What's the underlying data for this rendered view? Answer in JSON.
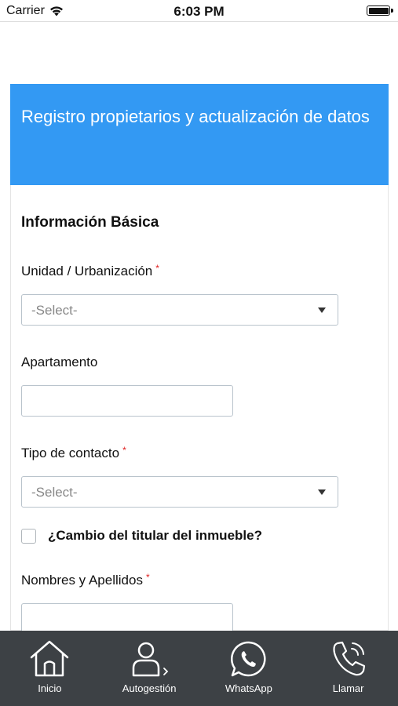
{
  "status_bar": {
    "carrier": "Carrier",
    "time": "6:03 PM",
    "wifi_icon": "wifi-icon",
    "battery_icon": "battery-icon"
  },
  "form": {
    "header_title": "Registro propietarios y actualización de datos",
    "header_color": "#3399f3",
    "section_title": "Información Básica",
    "fields": {
      "unidad": {
        "label": "Unidad / Urbanización",
        "required_mark": "*",
        "value": "-Select-"
      },
      "apartamento": {
        "label": "Apartamento",
        "value": ""
      },
      "tipo_contacto": {
        "label": "Tipo de contacto",
        "required_mark": "*",
        "value": "-Select-"
      },
      "cambio_titular": {
        "label": "¿Cambio del titular del inmueble?",
        "checked": false
      },
      "nombres": {
        "label": "Nombres y Apellidos",
        "required_mark": "*",
        "value": ""
      }
    },
    "required_color": "#e02020"
  },
  "bottom_nav": {
    "background": "#3d4145",
    "items": [
      {
        "label": "Inicio",
        "icon": "home-icon"
      },
      {
        "label": "Autogestión",
        "icon": "user-icon"
      },
      {
        "label": "WhatsApp",
        "icon": "whatsapp-icon"
      },
      {
        "label": "Llamar",
        "icon": "phone-icon"
      }
    ]
  }
}
